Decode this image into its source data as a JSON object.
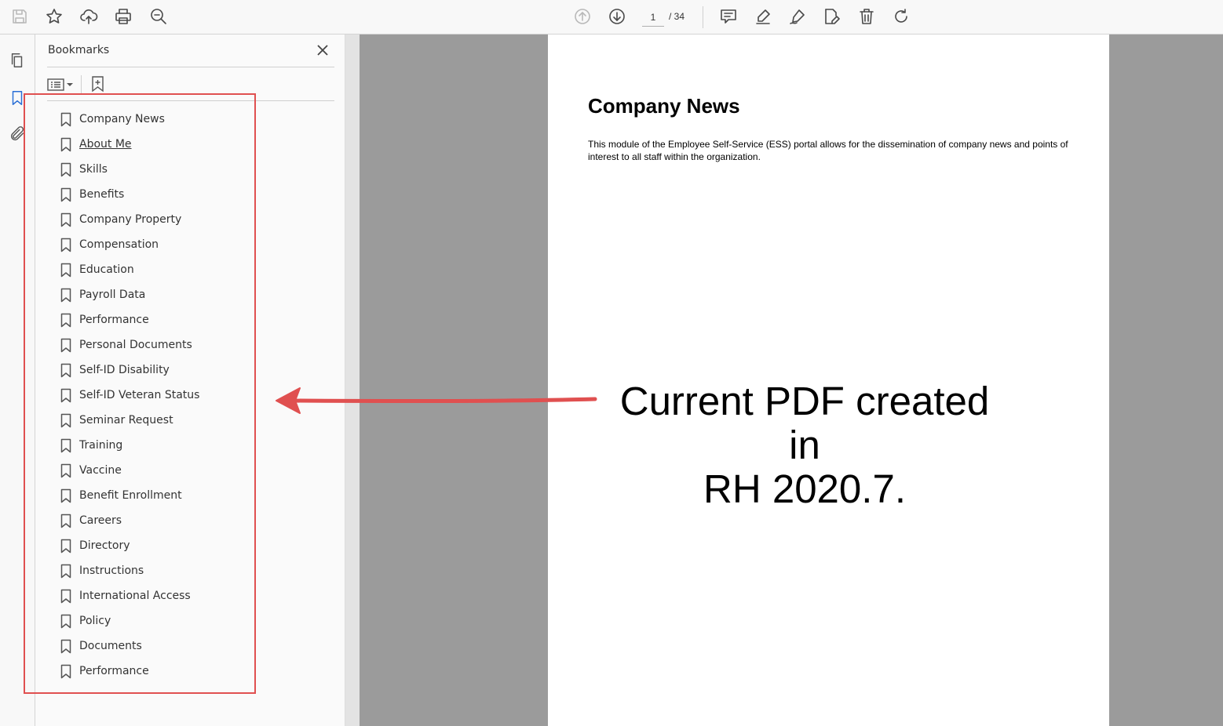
{
  "toolbar": {
    "page_current": "1",
    "page_total": "/ 34"
  },
  "panel": {
    "title": "Bookmarks"
  },
  "bookmarks": [
    "Company News",
    "About Me",
    "Skills",
    "Benefits",
    "Company Property",
    "Compensation",
    "Education",
    "Payroll Data",
    "Performance",
    "Personal Documents",
    "Self-ID Disability",
    "Self-ID Veteran Status",
    "Seminar Request",
    "Training",
    "Vaccine",
    "Benefit Enrollment",
    "Careers",
    "Directory",
    "Instructions",
    "International Access",
    "Policy",
    "Documents",
    "Performance"
  ],
  "hovered_bookmark_index": 1,
  "document": {
    "title": "Company News",
    "body": "This module of the Employee Self-Service (ESS) portal allows for the dissemination of company news and points of interest to all staff within the organization."
  },
  "annotation": {
    "line1": "Current PDF created in",
    "line2": "RH 2020.7.",
    "color": "#e05050"
  },
  "colors": {
    "accent": "#2a6fd6",
    "doc_bg": "#9b9b9b"
  }
}
